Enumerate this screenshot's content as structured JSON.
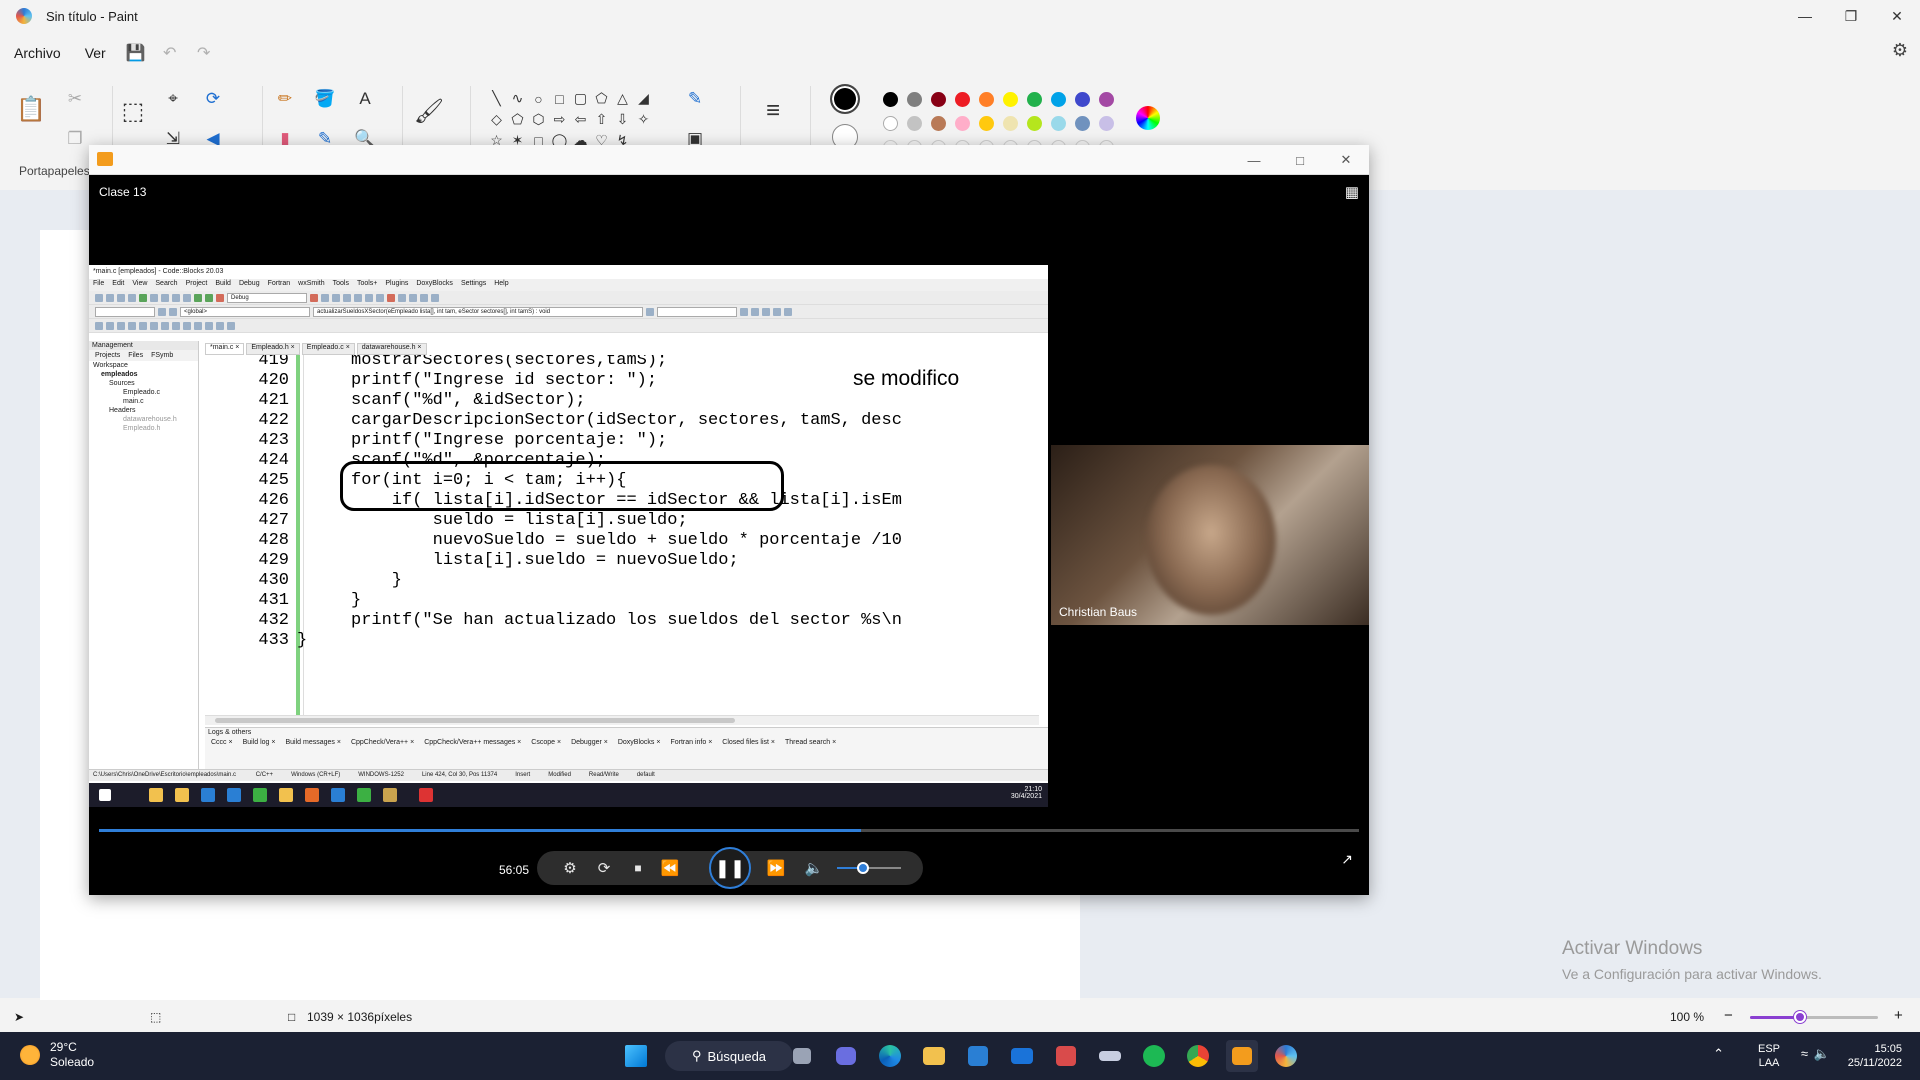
{
  "paint": {
    "window_title": "Sin título - Paint",
    "menu": {
      "file": "Archivo",
      "view": "Ver"
    },
    "ribbon": {
      "clipboard_label": "Portapapeles"
    },
    "status": {
      "canvas_size": "1039 × 1036píxeles",
      "zoom": "100 %",
      "zoom_fraction": 0.39
    },
    "palette": [
      "#000000",
      "#7f7f7f",
      "#880015",
      "#ed1c24",
      "#ff7f27",
      "#fff200",
      "#22b14c",
      "#00a2e8",
      "#3f48cc",
      "#a349a4",
      "#ffffff",
      "#c3c3c3",
      "#b97a57",
      "#ffaec9",
      "#ffc90e",
      "#efe4b0",
      "#b5e61d",
      "#99d9ea",
      "#7092be",
      "#c8bfe7"
    ]
  },
  "activation": {
    "line1": "Activar Windows",
    "line2": "Ve a Configuración para activar Windows."
  },
  "player": {
    "clip_title": "Clase 13",
    "timecode": "56:05",
    "progress": 0.605,
    "volume": 0.4,
    "speaker_name": "Christian Baus"
  },
  "recording": {
    "ide_title": "*main.c [empleados] - Code::Blocks 20.03",
    "menu": [
      "File",
      "Edit",
      "View",
      "Search",
      "Project",
      "Build",
      "Debug",
      "Fortran",
      "wxSmith",
      "Tools",
      "Tools+",
      "Plugins",
      "DoxyBlocks",
      "Settings",
      "Help"
    ],
    "build_target": "Debug",
    "scope": "<global>",
    "function_sig": "actualizarSueldosXSector(eEmpleado lista[], int tam, eSector sectores[], int tamS) : void",
    "management": {
      "header": "Management",
      "tabs": [
        "Projects",
        "Files",
        "FSymb"
      ],
      "tree": [
        "Workspace",
        "empleados",
        "Sources",
        "Empleado.c",
        "main.c",
        "Headers",
        "datawarehouse.h",
        "Empleado.h"
      ]
    },
    "editor_tabs": [
      "*main.c",
      "Empleado.h",
      "Empleado.c",
      "datawarehouse.h"
    ],
    "note": "se modifico",
    "code": [
      {
        "n": "419",
        "indent": 0,
        "text": "mostrarSectores(sectores,tamS);"
      },
      {
        "n": "420",
        "indent": 0,
        "text": "printf(\"Ingrese id sector: \");"
      },
      {
        "n": "421",
        "indent": 0,
        "text": "scanf(\"%d\", &idSector);"
      },
      {
        "n": "422",
        "indent": 0,
        "text": "cargarDescripcionSector(idSector, sectores, tamS, desc"
      },
      {
        "n": "423",
        "indent": 0,
        "text": "printf(\"Ingrese porcentaje: \");"
      },
      {
        "n": "424",
        "indent": 0,
        "text": "scanf(\"%d\", &porcentaje);"
      },
      {
        "n": "425",
        "indent": 0,
        "text": "for(int i=0; i < tam; i++){"
      },
      {
        "n": "426",
        "indent": 1,
        "text": "if( lista[i].idSector == idSector && lista[i].isEm"
      },
      {
        "n": "427",
        "indent": 2,
        "text": "sueldo = lista[i].sueldo;"
      },
      {
        "n": "428",
        "indent": 2,
        "text": "nuevoSueldo = sueldo + sueldo * porcentaje /10"
      },
      {
        "n": "429",
        "indent": 2,
        "text": "lista[i].sueldo = nuevoSueldo;"
      },
      {
        "n": "430",
        "indent": 1,
        "text": "}"
      },
      {
        "n": "431",
        "indent": 0,
        "text": "}"
      },
      {
        "n": "432",
        "indent": 0,
        "text": "printf(\"Se han actualizado los sueldos del sector %s\\n"
      },
      {
        "n": "433",
        "indent": -1,
        "text": "}"
      }
    ],
    "logs_header": "Logs & others",
    "log_tabs": [
      "Cccc",
      "Build log",
      "Build messages",
      "CppCheck/Vera++",
      "CppCheck/Vera++ messages",
      "Cscope",
      "Debugger",
      "DoxyBlocks",
      "Fortran info",
      "Closed files list",
      "Thread search"
    ],
    "status_path": "C:\\Users\\Chris\\OneDrive\\Escritorio\\empleados\\main.c",
    "status_items": [
      "C/C++",
      "Windows (CR+LF)",
      "WINDOWS-1252",
      "Line 424, Col 30, Pos 11374",
      "Insert",
      "Modified",
      "Read/Write",
      "default"
    ],
    "win10_time": "21:10",
    "win10_date": "30/4/2021"
  },
  "taskbar": {
    "temperature": "29°C",
    "weather": "Soleado",
    "search": "Búsqueda",
    "lang1": "ESP",
    "lang2": "LAA",
    "time": "15:05",
    "date": "25/11/2022"
  }
}
